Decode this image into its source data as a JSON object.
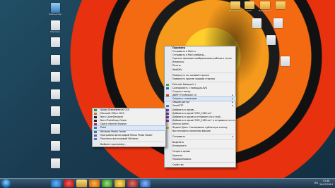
{
  "desktop_icons_left": [
    {
      "label": "Компьютер",
      "kind": "pc"
    },
    {
      "label": "Корзина",
      "kind": "file"
    },
    {
      "label": "",
      "kind": "file"
    },
    {
      "label": "",
      "kind": "file"
    },
    {
      "label": "",
      "kind": "file"
    },
    {
      "label": "",
      "kind": "file"
    },
    {
      "label": "",
      "kind": "file"
    },
    {
      "label": "",
      "kind": "file"
    },
    {
      "label": "",
      "kind": "file"
    },
    {
      "label": "",
      "kind": "file"
    }
  ],
  "desktop_icons_right": [
    {
      "label": "Программы",
      "kind": "folder"
    },
    {
      "label": "CCC",
      "kind": "folder"
    },
    {
      "label": "Документы",
      "kind": "folder"
    },
    {
      "label": "",
      "kind": "folder"
    },
    {
      "label": "",
      "kind": "file"
    },
    {
      "label": "",
      "kind": "file"
    },
    {
      "label": "",
      "kind": "file"
    },
    {
      "label": "",
      "kind": "file"
    }
  ],
  "context_menu": {
    "items": [
      {
        "label": "Просмотр",
        "bold": true
      },
      {
        "label": "Отправить в Mail.ru"
      },
      {
        "label": "Отправить в Mail альбомы..."
      },
      {
        "label": "Сделать фоновым изображением рабочего стола"
      },
      {
        "label": "Изменить"
      },
      {
        "label": "Печать"
      },
      {
        "label": "WebDAV"
      },
      {
        "sep": true
      },
      {
        "label": "Повернуть по часовой стрелке"
      },
      {
        "label": "Повернуть против часовой стрелки"
      },
      {
        "sep": true
      },
      {
        "label": "Edit with Notepad++",
        "icon": "#5a9e3a"
      },
      {
        "label": "Сканировать с помощью AVG",
        "icon": "#2f66b3"
      },
      {
        "label": "Открыть папку"
      },
      {
        "label": "ABBYY FineReader 10",
        "icon": "#d23a2a",
        "arrow": true
      },
      {
        "label": "Открыть с помощью",
        "arrow": true,
        "hl": true
      },
      {
        "label": "Общий доступ",
        "arrow": true
      },
      {
        "label": "SmartFTP",
        "icon": "#3a7fd0",
        "arrow": true
      },
      {
        "label": "Добавить в архив...",
        "icon": "#8b3aa8"
      },
      {
        "label": "Добавить в архив \"DSC_2085.rar\"",
        "icon": "#8b3aa8"
      },
      {
        "label": "Добавить в архив и отправить по e-mail...",
        "icon": "#8b3aa8"
      },
      {
        "label": "Добавить в архив \"DSC_2085.rar\" и отправить по e-mail",
        "icon": "#8b3aa8"
      },
      {
        "label": "Ammyy Admin"
      },
      {
        "label": "Яндекс.Диск: Скопировать публичную ссылку",
        "icon": "#e0b020"
      },
      {
        "label": "Восстановить прежнюю версию"
      },
      {
        "sep": true
      },
      {
        "label": "Отправить",
        "arrow": true
      },
      {
        "sep": true
      },
      {
        "label": "Вырезать"
      },
      {
        "label": "Копировать"
      },
      {
        "sep": true
      },
      {
        "label": "Создать ярлык"
      },
      {
        "label": "Удалить"
      },
      {
        "label": "Переименовать"
      },
      {
        "sep": true
      },
      {
        "label": "Свойства"
      }
    ]
  },
  "open_with_menu": {
    "items": [
      {
        "label": "Adobe Dreamweaver CS5",
        "icon": "#3e8a3e"
      },
      {
        "label": "Microsoft Office 2010",
        "icon": "#d96b1e"
      },
      {
        "label": "Nero CoverDesigner",
        "icon": "#222"
      },
      {
        "label": "Nero PhotoSnap Viewer",
        "icon": "#222"
      },
      {
        "label": "Opera Internet Browser",
        "icon": "#cc1f1f"
      },
      {
        "label": "Paint",
        "icon": "#3a78c9",
        "hl": true
      },
      {
        "label": "Windows Media Center",
        "icon": "#2e8b57"
      },
      {
        "label": "Программа фотографий Picasa Photo Viewer",
        "icon": "#7a4bb5"
      },
      {
        "label": "Просмотр фотографий Windows",
        "icon": "#3a7fd0"
      },
      {
        "sep": true
      },
      {
        "label": "Выбрать программу..."
      }
    ]
  },
  "taskbar": {
    "tray_text": "RU",
    "time": "13:48",
    "date": "26.03.2014"
  }
}
